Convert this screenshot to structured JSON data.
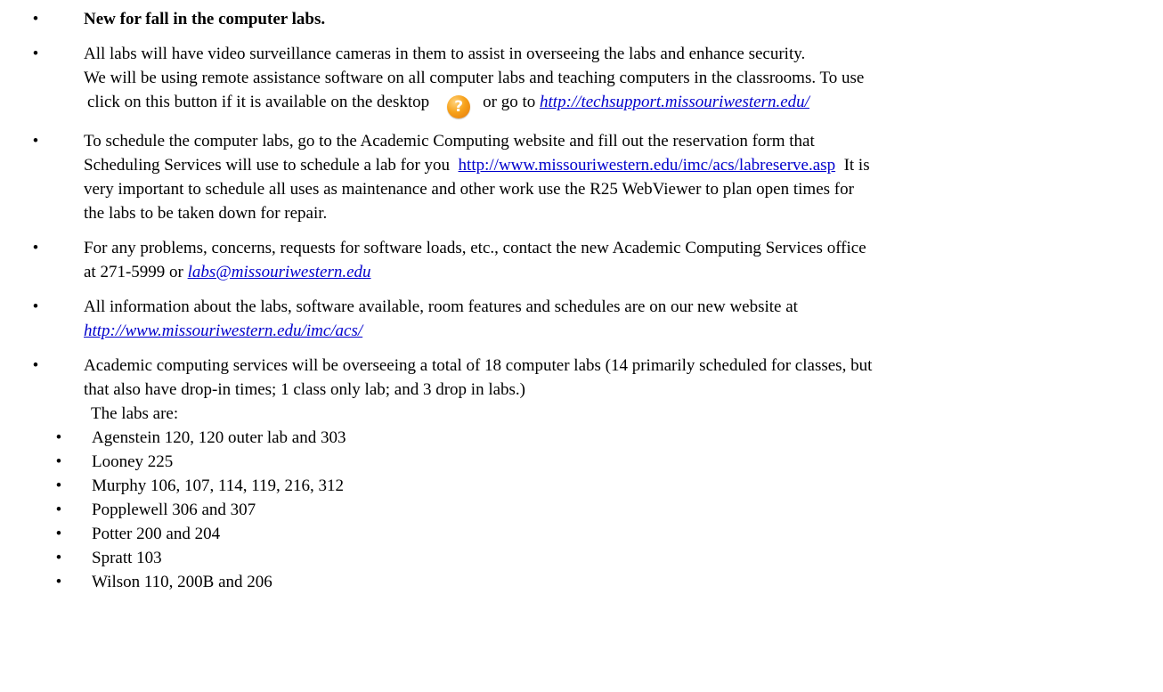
{
  "bullet_char": "•",
  "items": [
    {
      "type": "heading",
      "text": "New for fall in the computer labs."
    },
    {
      "type": "cameras",
      "line1": "All labs will have video surveillance cameras in them to assist in overseeing the labs and enhance security.",
      "line2": "We will be using remote assistance software on all computer labs and teaching computers in the classrooms. To use",
      "line3_pre": "click on this button if it is available on the desktop",
      "help_icon": {
        "name": "help-icon",
        "glyph": "?",
        "color": "#f7a21b"
      },
      "line3_mid": "or go to",
      "line3_link": "http://techsupport.missouriwestern.edu/"
    },
    {
      "type": "schedule",
      "line1": "To schedule the computer labs, go to the Academic Computing website and fill out the reservation form that",
      "line2_pre": "Scheduling Services will use to schedule a lab for you",
      "line2_link": "http://www.missouriwestern.edu/imc/acs/labreserve.asp",
      "line2_post": "It is",
      "line3": "very important to schedule all uses as maintenance and other work use the R25 WebViewer to plan open times for",
      "line4": "the labs to be taken down for repair."
    },
    {
      "type": "problems",
      "line1": "For any problems, concerns, requests for software loads, etc., contact the new Academic Computing Services office",
      "line2_pre": "at 271-5999 or",
      "line2_link": "labs@missouriwestern.edu"
    },
    {
      "type": "info",
      "line1": "All information about the labs, software available, room features and schedules are on our new website at",
      "line2_link": "http://www.missouriwestern.edu/imc/acs/"
    },
    {
      "type": "overview",
      "line1": "Academic computing services will be overseeing a total of 18 computer labs (14 primarily scheduled for classes, but",
      "line2": "that also have drop-in times; 1 class only lab; and 3 drop in labs.)",
      "labs_heading": "The labs are:",
      "labs": [
        "Agenstein 120, 120 outer lab and 303",
        "Looney 225",
        "Murphy 106, 107, 114, 119, 216, 312",
        "Popplewell 306 and 307",
        "Potter 200 and 204",
        "Spratt 103",
        "Wilson 110, 200B and 206"
      ]
    }
  ]
}
